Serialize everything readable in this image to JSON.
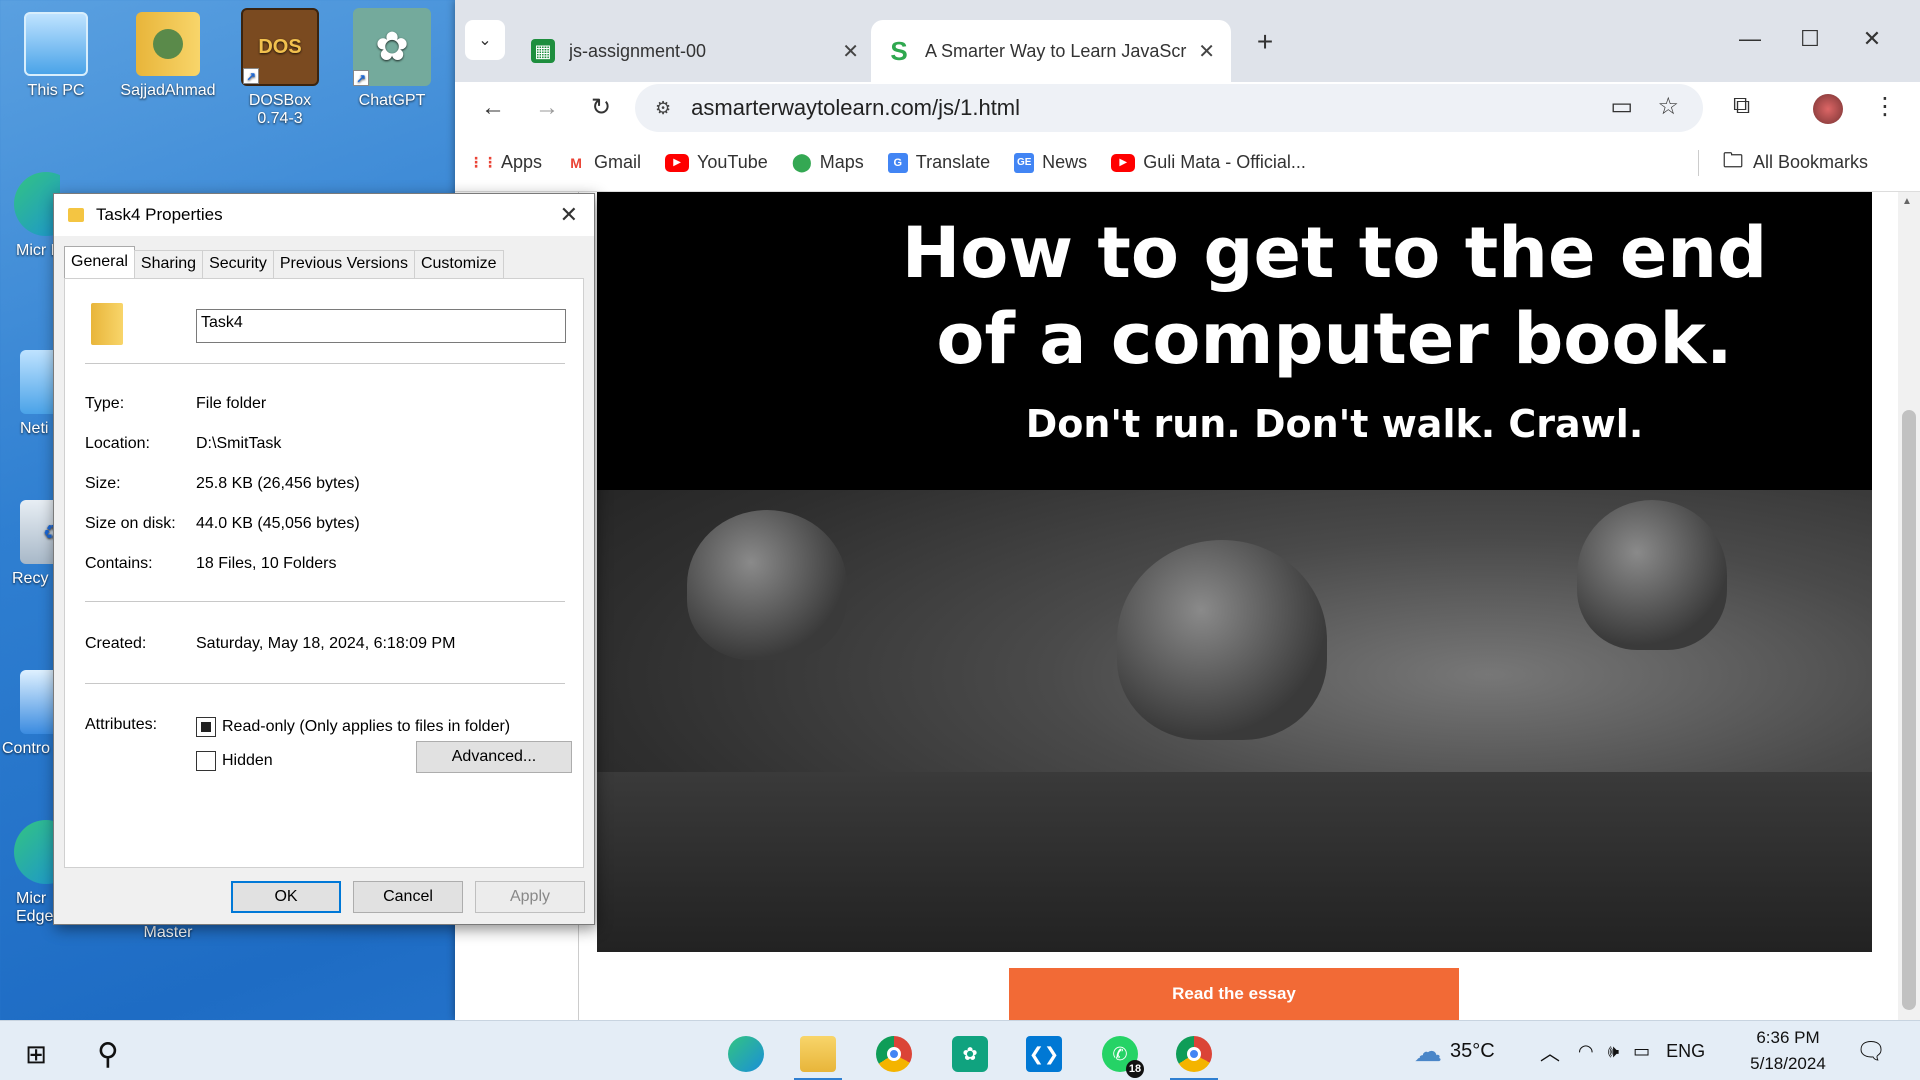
{
  "desktop": {
    "icons": [
      {
        "label": "This PC",
        "icon": "monitor-icon"
      },
      {
        "label": "SajjadAhmad",
        "icon": "user-folder-icon"
      },
      {
        "label": "DOSBox 0.74-3",
        "icon": "dosbox-icon",
        "glyph": "DOS"
      },
      {
        "label": "ChatGPT",
        "icon": "chatgpt-icon"
      },
      {
        "label": "Micr Ec",
        "icon": "edge-icon"
      },
      {
        "label": "Neti",
        "icon": "network-icon"
      },
      {
        "label": "Recy",
        "icon": "recycle-bin-icon"
      },
      {
        "label": "Contro",
        "icon": "control-panel-icon"
      },
      {
        "label": "Micr Edge",
        "icon": "edge-icon"
      },
      {
        "label": "Master",
        "icon": "folder-icon"
      }
    ]
  },
  "browser": {
    "tabs": [
      {
        "title": "js-assignment-00",
        "favicon": "sheets-icon",
        "favicon_color": "#1e8e3e"
      },
      {
        "title": "A Smarter Way to Learn JavaScr",
        "favicon": "s-logo-icon",
        "favicon_glyph": "S",
        "favicon_color": "#2fa84f"
      }
    ],
    "url": "asmarterwaytolearn.com/js/1.html",
    "bookmarks": [
      {
        "label": "Apps",
        "icon": "apps-grid-icon"
      },
      {
        "label": "Gmail",
        "icon": "gmail-icon",
        "glyph": "M"
      },
      {
        "label": "YouTube",
        "icon": "youtube-icon"
      },
      {
        "label": "Maps",
        "icon": "maps-pin-icon"
      },
      {
        "label": "Translate",
        "icon": "translate-icon"
      },
      {
        "label": "News",
        "icon": "news-icon"
      },
      {
        "label": "Guli Mata - Official...",
        "icon": "youtube-icon"
      }
    ],
    "all_bookmarks": "All Bookmarks",
    "page": {
      "title_line1": "How to get to the end",
      "title_line2": "of a computer book.",
      "subtitle": "Don't run. Don't walk. Crawl.",
      "cta": "Read the essay",
      "cta_color": "#f26a36"
    }
  },
  "dialog": {
    "title": "Task4 Properties",
    "tabs": [
      "General",
      "Sharing",
      "Security",
      "Previous Versions",
      "Customize"
    ],
    "active_tab": "General",
    "name": "Task4",
    "properties": [
      {
        "label": "Type:",
        "value": "File folder"
      },
      {
        "label": "Location:",
        "value": "D:\\SmitTask"
      },
      {
        "label": "Size:",
        "value": "25.8 KB (26,456 bytes)"
      },
      {
        "label": "Size on disk:",
        "value": "44.0 KB (45,056 bytes)"
      },
      {
        "label": "Contains:",
        "value": "18 Files, 10 Folders"
      }
    ],
    "created_label": "Created:",
    "created_value": "Saturday, May 18, 2024, 6:18:09 PM",
    "attributes_label": "Attributes:",
    "readonly_label": "Read-only (Only applies to files in folder)",
    "readonly_checked": true,
    "hidden_label": "Hidden",
    "hidden_checked": false,
    "advanced_label": "Advanced...",
    "buttons": {
      "ok": "OK",
      "cancel": "Cancel",
      "apply": "Apply"
    }
  },
  "taskbar": {
    "apps": [
      {
        "name": "edge",
        "icon": "edge-icon",
        "color": "#1a8fd8"
      },
      {
        "name": "file-explorer",
        "icon": "file-explorer-icon",
        "color": "#f4c542"
      },
      {
        "name": "chrome",
        "icon": "chrome-icon",
        "color": "#db4437"
      },
      {
        "name": "chatgpt",
        "icon": "chatgpt-icon",
        "color": "#10a37f"
      },
      {
        "name": "vscode",
        "icon": "vscode-icon",
        "color": "#0078d4"
      },
      {
        "name": "whatsapp",
        "icon": "whatsapp-icon",
        "color": "#25d366",
        "badge": "18"
      },
      {
        "name": "chrome-2",
        "icon": "chrome-icon",
        "color": "#db4437"
      }
    ],
    "weather": "35°C",
    "language": "ENG",
    "time": "6:36 PM",
    "date": "5/18/2024"
  }
}
